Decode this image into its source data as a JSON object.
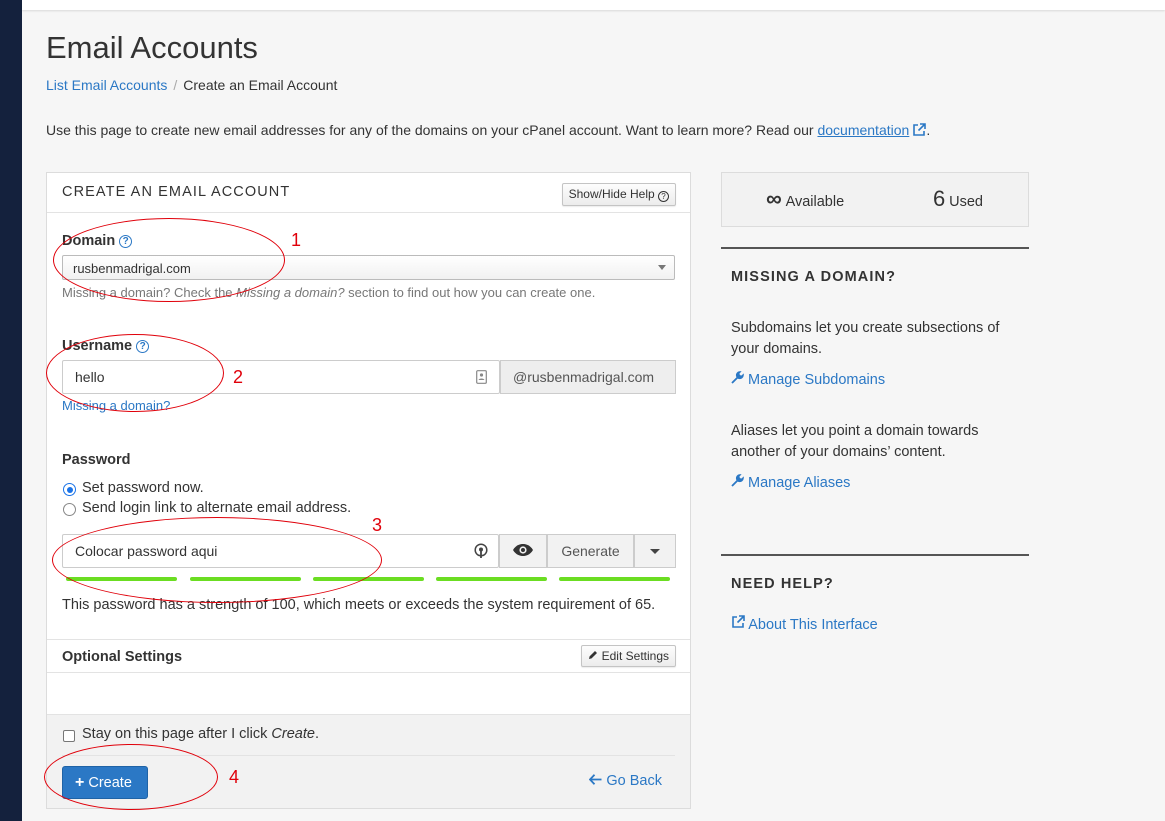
{
  "page": {
    "title": "Email Accounts",
    "breadcrumb": {
      "link": "List Email Accounts",
      "current": "Create an Email Account"
    },
    "intro": "Use this page to create new email addresses for any of the domains on your cPanel account. Want to learn more? Read our ",
    "intro_link": "documentation",
    "intro_end": "."
  },
  "form": {
    "title": "CREATE AN EMAIL ACCOUNT",
    "help_button": "Show/Hide Help",
    "domain": {
      "label": "Domain",
      "value": "rusbenmadrigal.com",
      "help_pre": "Missing a domain? Check the ",
      "help_em": "Missing a domain?",
      "help_post": " section to find out how you can create one."
    },
    "username": {
      "label": "Username",
      "value": "hello",
      "suffix": "@rusbenmadrigal.com",
      "missing_link": "Missing a domain?"
    },
    "password": {
      "label": "Password",
      "option_set": "Set password now.",
      "option_link": "Send login link to alternate email address.",
      "value": "Colocar password aqui",
      "generate": "Generate",
      "strength_text": "This password has a strength of 100, which meets or exceeds the system requirement of 65.",
      "strength": 100
    },
    "optional": {
      "title": "Optional Settings",
      "edit_button": "Edit Settings"
    },
    "stay": {
      "pre": "Stay on this page after I click ",
      "em": "Create",
      "post": "."
    },
    "create_button": "Create",
    "go_back": "Go Back"
  },
  "stats": {
    "available_symbol": "∞",
    "available_label": "Available",
    "used_count": "6",
    "used_label": "Used"
  },
  "sidebar": {
    "missing_title": "MISSING A DOMAIN?",
    "subdomains_text": "Subdomains let you create subsections of your domains.",
    "subdomains_link": "Manage Subdomains",
    "aliases_text": "Aliases let you point a domain towards another of your domains’ content.",
    "aliases_link": "Manage Aliases",
    "help_title": "NEED HELP?",
    "about_link": "About This Interface"
  },
  "annotations": [
    "1",
    "2",
    "3",
    "4"
  ],
  "colors": {
    "accent": "#2b78c5",
    "strength": "#6bdd22",
    "annotation": "#e0000a",
    "sidebar_nav": "#14213d"
  }
}
